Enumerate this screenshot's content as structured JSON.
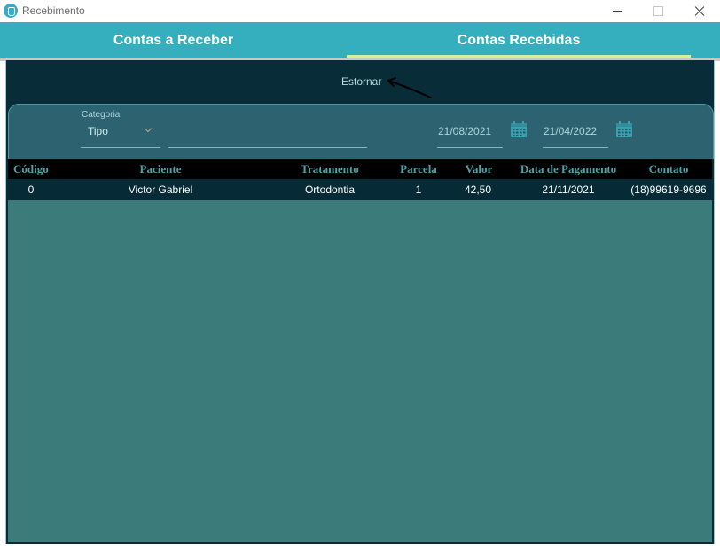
{
  "window": {
    "title": "Recebimento",
    "icon": "tooth-icon"
  },
  "tabs": [
    {
      "label": "Contas a Receber",
      "active": false
    },
    {
      "label": "Contas Recebidas",
      "active": true
    }
  ],
  "actions": {
    "estornar_label": "Estornar"
  },
  "filters": {
    "category_label": "Categoria",
    "category_value": "Tipo",
    "search_value": "",
    "date_start": "21/08/2021",
    "date_end": "21/04/2022"
  },
  "table": {
    "columns": [
      "Código",
      "Paciente",
      "Tratamento",
      "Parcela",
      "Valor",
      "Data de Pagamento",
      "Contato"
    ],
    "rows": [
      [
        "0",
        "Victor Gabriel",
        "Ortodontia",
        "1",
        "42,50",
        "21/11/2021",
        "(18)99619-9696"
      ]
    ]
  },
  "colors": {
    "accent": "#35aebd",
    "active_tab_underline": "#d7ef9d",
    "panel_dark": "#082d38",
    "table_background": "#3b7b79",
    "header_text": "#4fa3a6"
  }
}
